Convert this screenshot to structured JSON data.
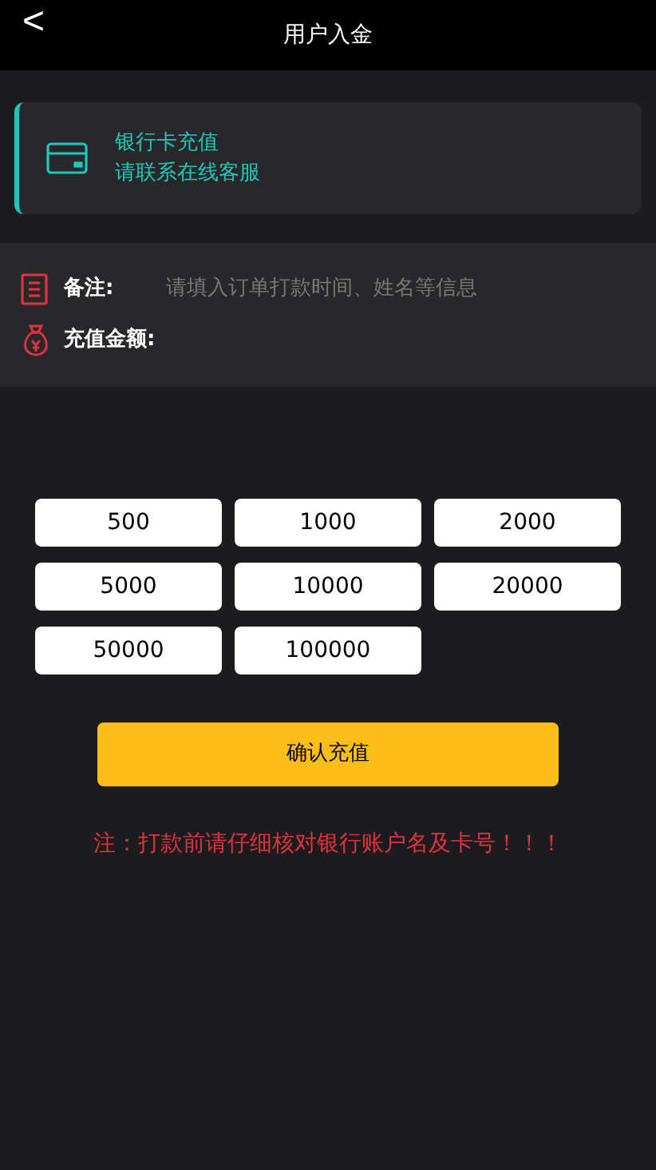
{
  "header": {
    "back": "<",
    "title": "用户入金"
  },
  "bank_card": {
    "title": "银行卡充值",
    "subtitle": "请联系在线客服"
  },
  "form": {
    "remark_label": "备注:",
    "remark_placeholder": "请填入订单打款时间、姓名等信息",
    "amount_label": "充值金额:"
  },
  "amounts": [
    "500",
    "1000",
    "2000",
    "5000",
    "10000",
    "20000",
    "50000",
    "100000"
  ],
  "confirm": "确认充值",
  "notice": "注：打款前请仔细核对银行账户名及卡号！！！"
}
